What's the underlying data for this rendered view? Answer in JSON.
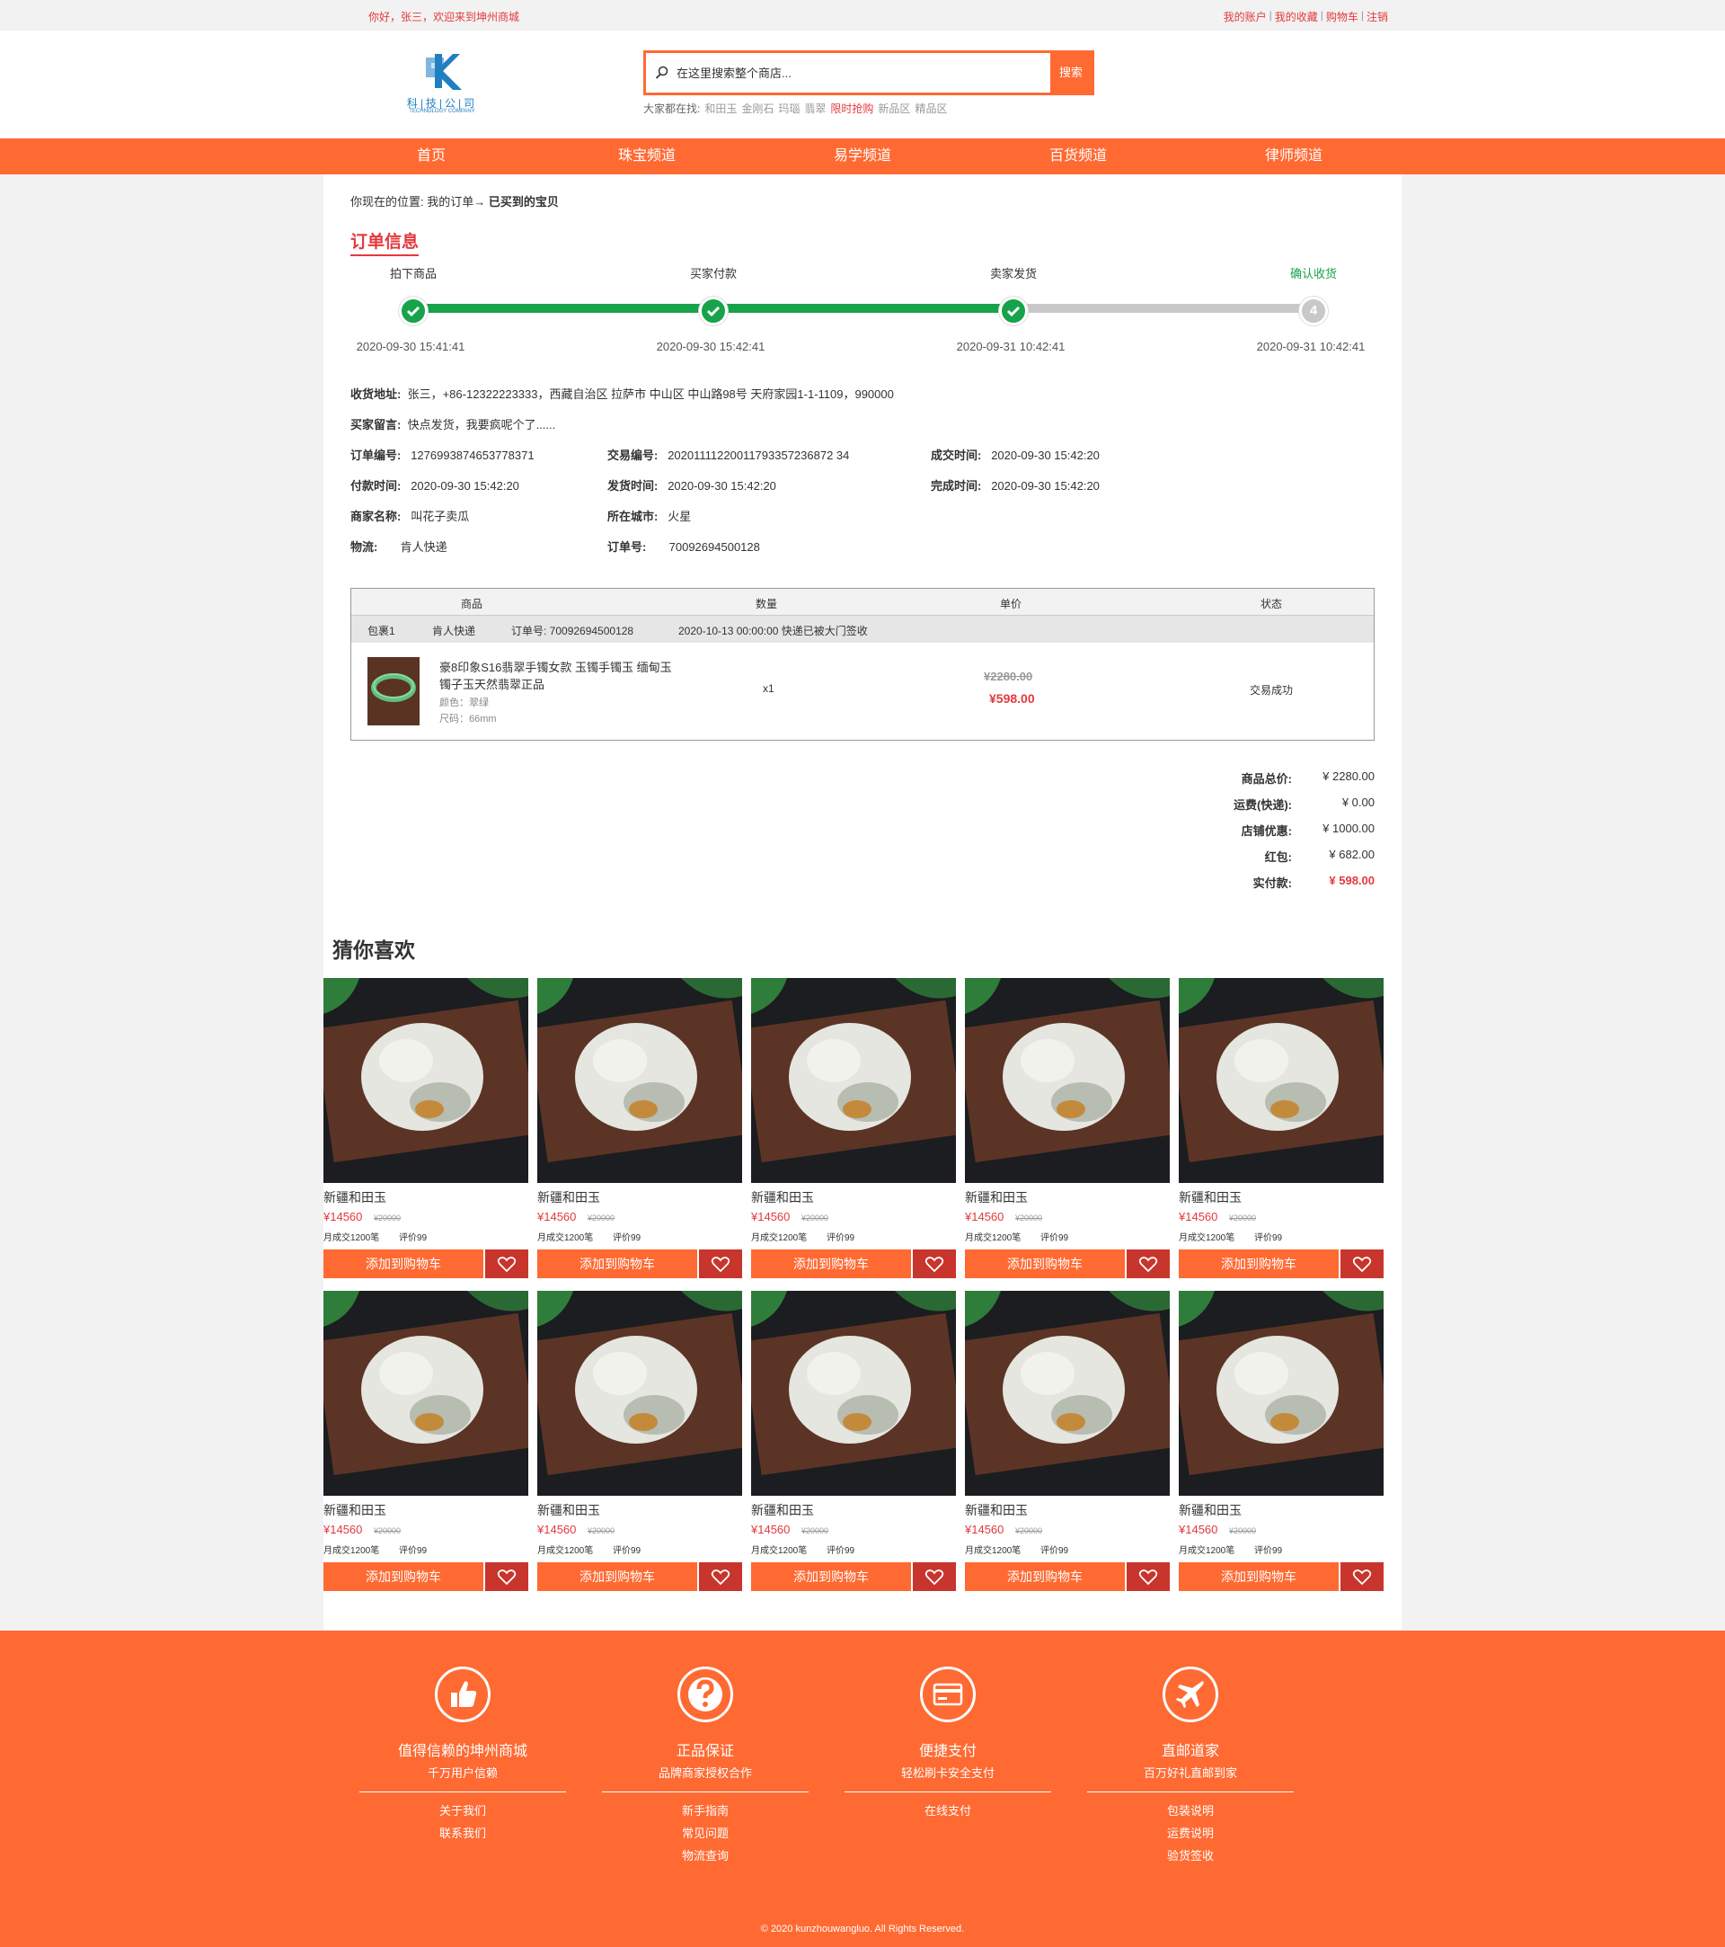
{
  "topbar": {
    "welcome": "你好，张三，欢迎来到坤州商城",
    "links": [
      "我的账户",
      "我的收藏",
      "购物车",
      "注销"
    ]
  },
  "header": {
    "logo_cn": "科|技|公|司",
    "logo_en": "TECHNOLOGY COMPANY",
    "search_placeholder": "在这里搜索整个商店...",
    "search_button": "搜索",
    "hot_label": "大家都在找:",
    "hot_terms": [
      "和田玉",
      "金刚石",
      "玛瑙",
      "翡翠",
      "限时抢购",
      "新品区",
      "精品区"
    ],
    "hot_highlight_index": 4
  },
  "nav": [
    "首页",
    "珠宝频道",
    "易学频道",
    "百货频道",
    "律师频道"
  ],
  "breadcrumb": {
    "prefix": "你现在的位置: 我的订单→ ",
    "current": "已买到的宝贝"
  },
  "order_section_title": "订单信息",
  "steps": [
    {
      "label": "拍下商品",
      "time": "2020-09-30 15:41:41",
      "done": true
    },
    {
      "label": "买家付款",
      "time": "2020-09-30 15:42:41",
      "done": true
    },
    {
      "label": "卖家发货",
      "time": "2020-09-31 10:42:41",
      "done": true
    },
    {
      "label": "确认收货",
      "time": "2020-09-31 10:42:41",
      "done": false,
      "number": "4"
    }
  ],
  "info": {
    "address_k": "收货地址:",
    "address_v": "张三，+86-12322223333，西藏自治区 拉萨市 中山区 中山路98号 天府家园1-1-1109，990000",
    "message_k": "买家留言:",
    "message_v": "快点发货，我要疯呢个了......",
    "order_no_k": "订单编号:",
    "order_no_v": "1276993874653778371",
    "trade_no_k": "交易编号:",
    "trade_no_v": "20201111220011793357236872 34",
    "deal_time_k": "成交时间:",
    "deal_time_v": "2020-09-30 15:42:20",
    "pay_time_k": "付款时间:",
    "pay_time_v": "2020-09-30 15:42:20",
    "ship_time_k": "发货时间:",
    "ship_time_v": "2020-09-30 15:42:20",
    "done_time_k": "完成时间:",
    "done_time_v": "2020-09-30 15:42:20",
    "merchant_k": "商家名称:",
    "merchant_v": "叫花子卖瓜",
    "city_k": "所在城市:",
    "city_v": "火星",
    "logistics_k": "物流:",
    "logistics_v": "肯人快递",
    "tracking_k": "订单号:",
    "tracking_v": "70092694500128"
  },
  "table": {
    "headers": [
      "商品",
      "数量",
      "单价",
      "状态"
    ],
    "package": [
      "包裹1",
      "肯人快递",
      "订单号: 70092694500128",
      "2020-10-13 00:00:00 快递已被大门签收"
    ],
    "item": {
      "name": "豪8印象S16翡翠手镯女款 玉镯手镯玉 缅甸玉镯子玉天然翡翠正品",
      "color": "颜色：翠绿",
      "size": "尺码：66mm",
      "qty": "x1",
      "old_price": "¥2280.00",
      "new_price": "¥598.00",
      "status": "交易成功"
    }
  },
  "summary": [
    {
      "k": "商品总价:",
      "v": "¥ 2280.00"
    },
    {
      "k": "运费(快递):",
      "v": "¥ 0.00"
    },
    {
      "k": "店铺优惠:",
      "v": "¥ 1000.00"
    },
    {
      "k": "红包:",
      "v": "¥ 682.00"
    },
    {
      "k": "实付款:",
      "v": "¥ 598.00"
    }
  ],
  "recommend": {
    "title": "猜你喜欢",
    "product": {
      "name": "新疆和田玉",
      "price": "¥14560",
      "old_price": "¥20000",
      "sold": "月成交1200笔",
      "reviews": "评价99",
      "add_cart": "添加到购物车"
    }
  },
  "footer": {
    "cols": [
      {
        "icon": "thumbs-up-icon",
        "title": "值得信赖的坤州商城",
        "sub": "千万用户信赖",
        "links": [
          "关于我们",
          "联系我们"
        ]
      },
      {
        "icon": "question-icon",
        "title": "正品保证",
        "sub": "品牌商家授权合作",
        "links": [
          "新手指南",
          "常见问题",
          "物流查询"
        ]
      },
      {
        "icon": "credit-card-icon",
        "title": "便捷支付",
        "sub": "轻松刷卡安全支付",
        "links": [
          "在线支付"
        ]
      },
      {
        "icon": "airplane-icon",
        "title": "直邮道家",
        "sub": "百万好礼直邮到家",
        "links": [
          "包装说明",
          "运费说明",
          "验货签收"
        ]
      }
    ],
    "copyright": "© 2020 kunzhouwangluo. All Rights Reserved."
  },
  "colors": {
    "accent": "#ff6a33",
    "price_red": "#e4393c",
    "step_done": "#16a34a",
    "fav_red": "#c8352c"
  }
}
